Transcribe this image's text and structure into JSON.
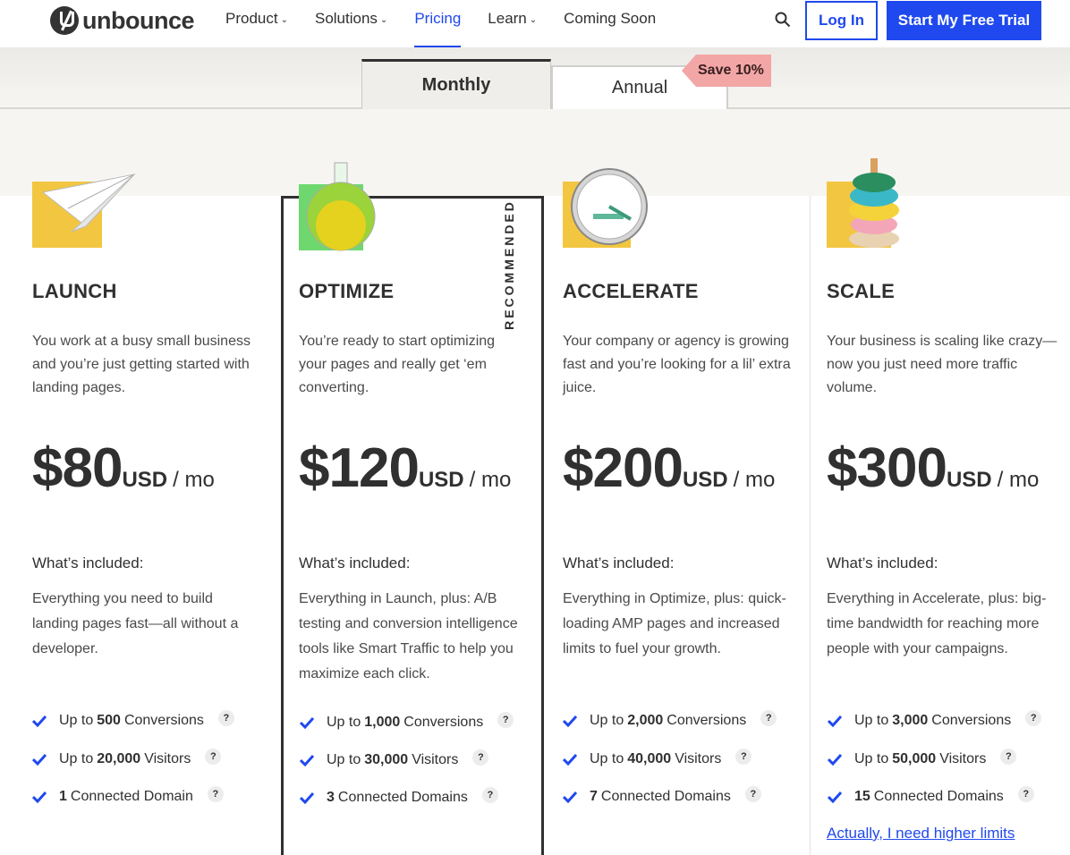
{
  "brand": {
    "logo_text": "unbounce",
    "accent": "#1f49ee"
  },
  "nav": {
    "items": [
      {
        "label": "Product",
        "has_caret": true
      },
      {
        "label": "Solutions",
        "has_caret": true
      },
      {
        "label": "Pricing",
        "has_caret": false,
        "active": true
      },
      {
        "label": "Learn",
        "has_caret": true
      },
      {
        "label": "Coming Soon",
        "has_caret": false
      }
    ],
    "caret": "⌄",
    "search_icon": "search-icon",
    "login_label": "Log In",
    "trial_label": "Start My Free Trial"
  },
  "billing": {
    "monthly_label": "Monthly",
    "annual_label": "Annual",
    "save_badge": "Save 10%",
    "selected": "Monthly"
  },
  "recommended_label": "RECOMMENDED",
  "plans": [
    {
      "name": "LAUNCH",
      "description": "You work at a busy small business and you’re just getting started with landing pages.",
      "price": "$80",
      "currency": "USD",
      "period": "/ mo",
      "included_title": "What’s included:",
      "included_desc": "Everything you need to build landing pages fast—all without a developer.",
      "features": [
        {
          "pre": "Up to",
          "num": "500",
          "post": "Conversions"
        },
        {
          "pre": "Up to",
          "num": "20,000",
          "post": "Visitors"
        },
        {
          "pre": "",
          "num": "1",
          "post": "Connected Domain"
        }
      ]
    },
    {
      "name": "OPTIMIZE",
      "description": "You’re ready to start optimizing your pages and really get ‘em converting.",
      "price": "$120",
      "currency": "USD",
      "period": "/ mo",
      "included_title": "What’s included:",
      "included_desc": "Everything in Launch, plus: A/B testing and conversion intelligence tools like Smart Traffic to help you maximize each click.",
      "features": [
        {
          "pre": "Up to",
          "num": "1,000",
          "post": "Conversions"
        },
        {
          "pre": "Up to",
          "num": "30,000",
          "post": "Visitors"
        },
        {
          "pre": "",
          "num": "3",
          "post": "Connected Domains"
        }
      ]
    },
    {
      "name": "ACCELERATE",
      "description": "Your company or agency is growing fast and you’re looking for a lil’ extra juice.",
      "price": "$200",
      "currency": "USD",
      "period": "/ mo",
      "included_title": "What’s included:",
      "included_desc": "Everything in Optimize, plus: quick-loading AMP pages and increased limits to fuel your growth.",
      "features": [
        {
          "pre": "Up to",
          "num": "2,000",
          "post": "Conversions"
        },
        {
          "pre": "Up to",
          "num": "40,000",
          "post": "Visitors"
        },
        {
          "pre": "",
          "num": "7",
          "post": "Connected Domains"
        }
      ]
    },
    {
      "name": "SCALE",
      "description": "Your business is scaling like crazy—now you just need more traffic volume.",
      "price": "$300",
      "currency": "USD",
      "period": "/ mo",
      "included_title": "What’s included:",
      "included_desc": "Everything in Accelerate, plus: big-time bandwidth for reaching more people with your campaigns.",
      "features": [
        {
          "pre": "Up to",
          "num": "3,000",
          "post": "Conversions"
        },
        {
          "pre": "Up to",
          "num": "50,000",
          "post": "Visitors"
        },
        {
          "pre": "",
          "num": "15",
          "post": "Connected Domains"
        }
      ]
    }
  ],
  "help_glyph": "?",
  "higher_limits_link": "Actually, I need higher limits"
}
